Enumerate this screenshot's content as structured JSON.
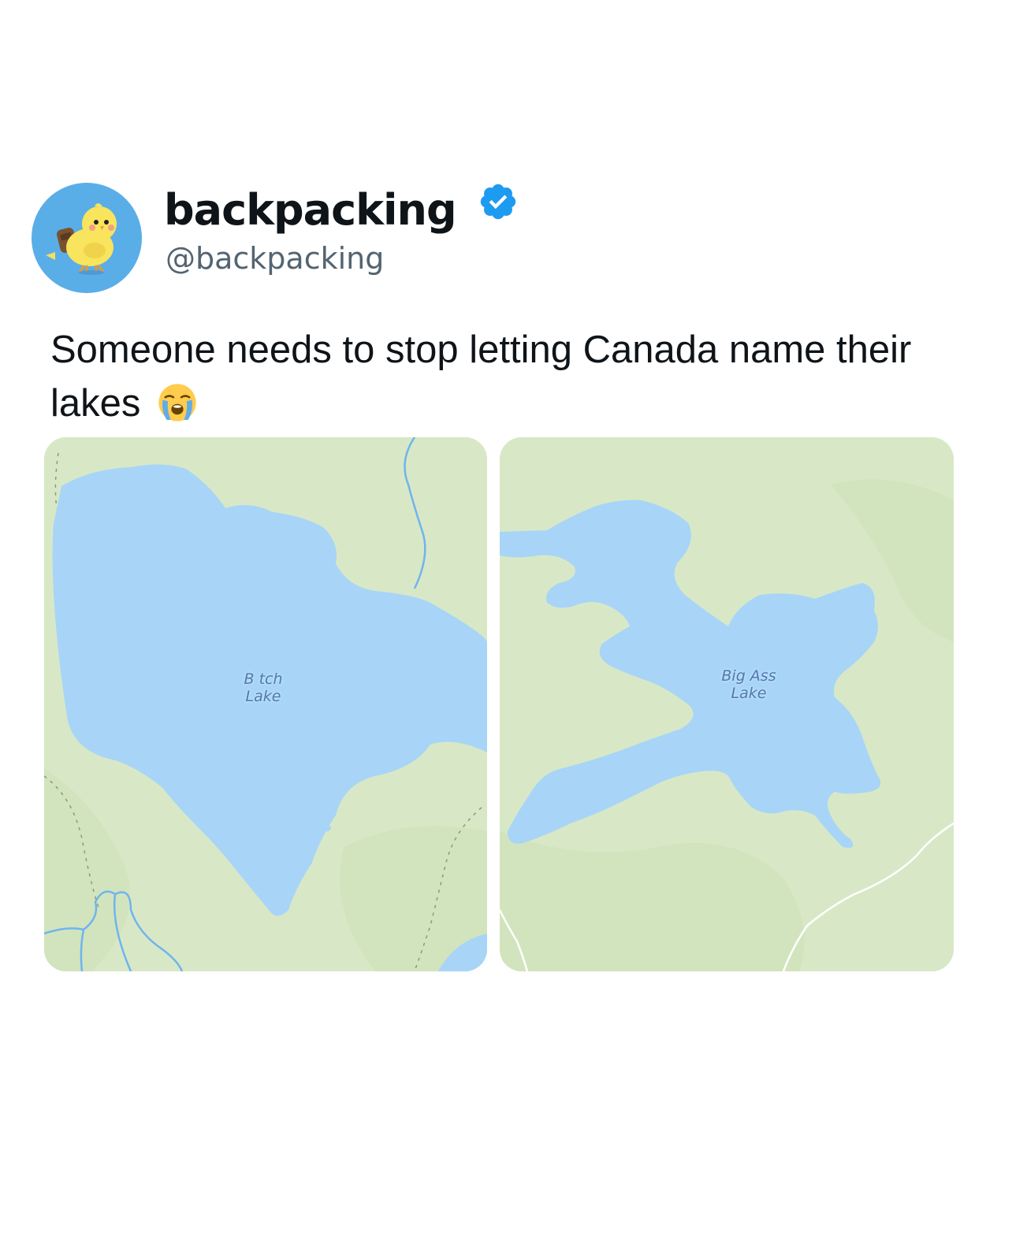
{
  "post": {
    "display_name": "backpacking",
    "handle": "@backpacking",
    "verified": true,
    "text_line1": "Someone needs to stop letting Canada name their",
    "text_line2": "lakes",
    "emoji": "loudly-crying-face"
  },
  "maps": [
    {
      "lake_label": "B tch\nLake"
    },
    {
      "lake_label": "Big Ass\nLake"
    }
  ],
  "colors": {
    "land": "#d8e8c6",
    "water": "#a8d5f7",
    "river": "#6fb4ef",
    "verified_badge": "#1d9bf0",
    "avatar_bg": "#5aaee8",
    "handle": "#536471",
    "label": "#4d78b2"
  }
}
